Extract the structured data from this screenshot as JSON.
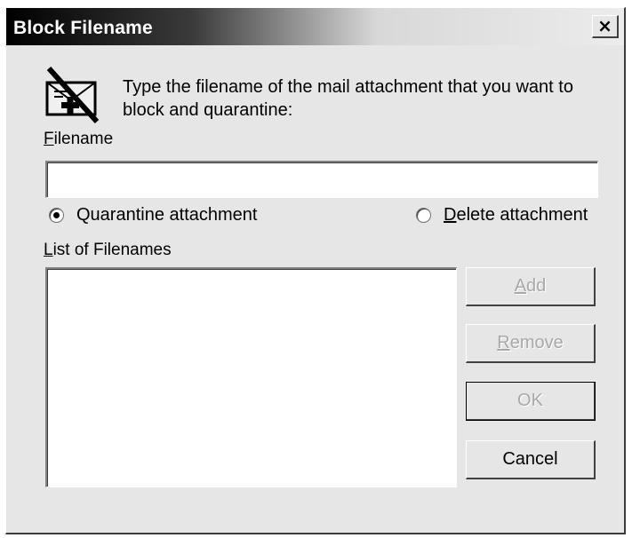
{
  "window": {
    "title": "Block Filename",
    "close_glyph": "×"
  },
  "icon": {
    "name": "mail-attachment-blocked-icon"
  },
  "instruction": "Type the filename of the mail attachment that you want to block and quarantine:",
  "filename": {
    "label_ul": "F",
    "label_rest": "ilename",
    "value": ""
  },
  "options": {
    "quarantine": {
      "label": "Quarantine attachment",
      "selected": true
    },
    "delete": {
      "label_ul": "D",
      "label_rest": "elete attachment",
      "selected": false
    }
  },
  "list": {
    "label_ul": "L",
    "label_rest": "ist of Filenames",
    "items": []
  },
  "buttons": {
    "add": {
      "label_ul": "A",
      "label_rest": "dd",
      "enabled": false
    },
    "remove": {
      "label_ul": "R",
      "label_rest": "emove",
      "enabled": false
    },
    "ok": {
      "label": "OK",
      "enabled": false
    },
    "cancel": {
      "label": "Cancel",
      "enabled": true
    }
  }
}
